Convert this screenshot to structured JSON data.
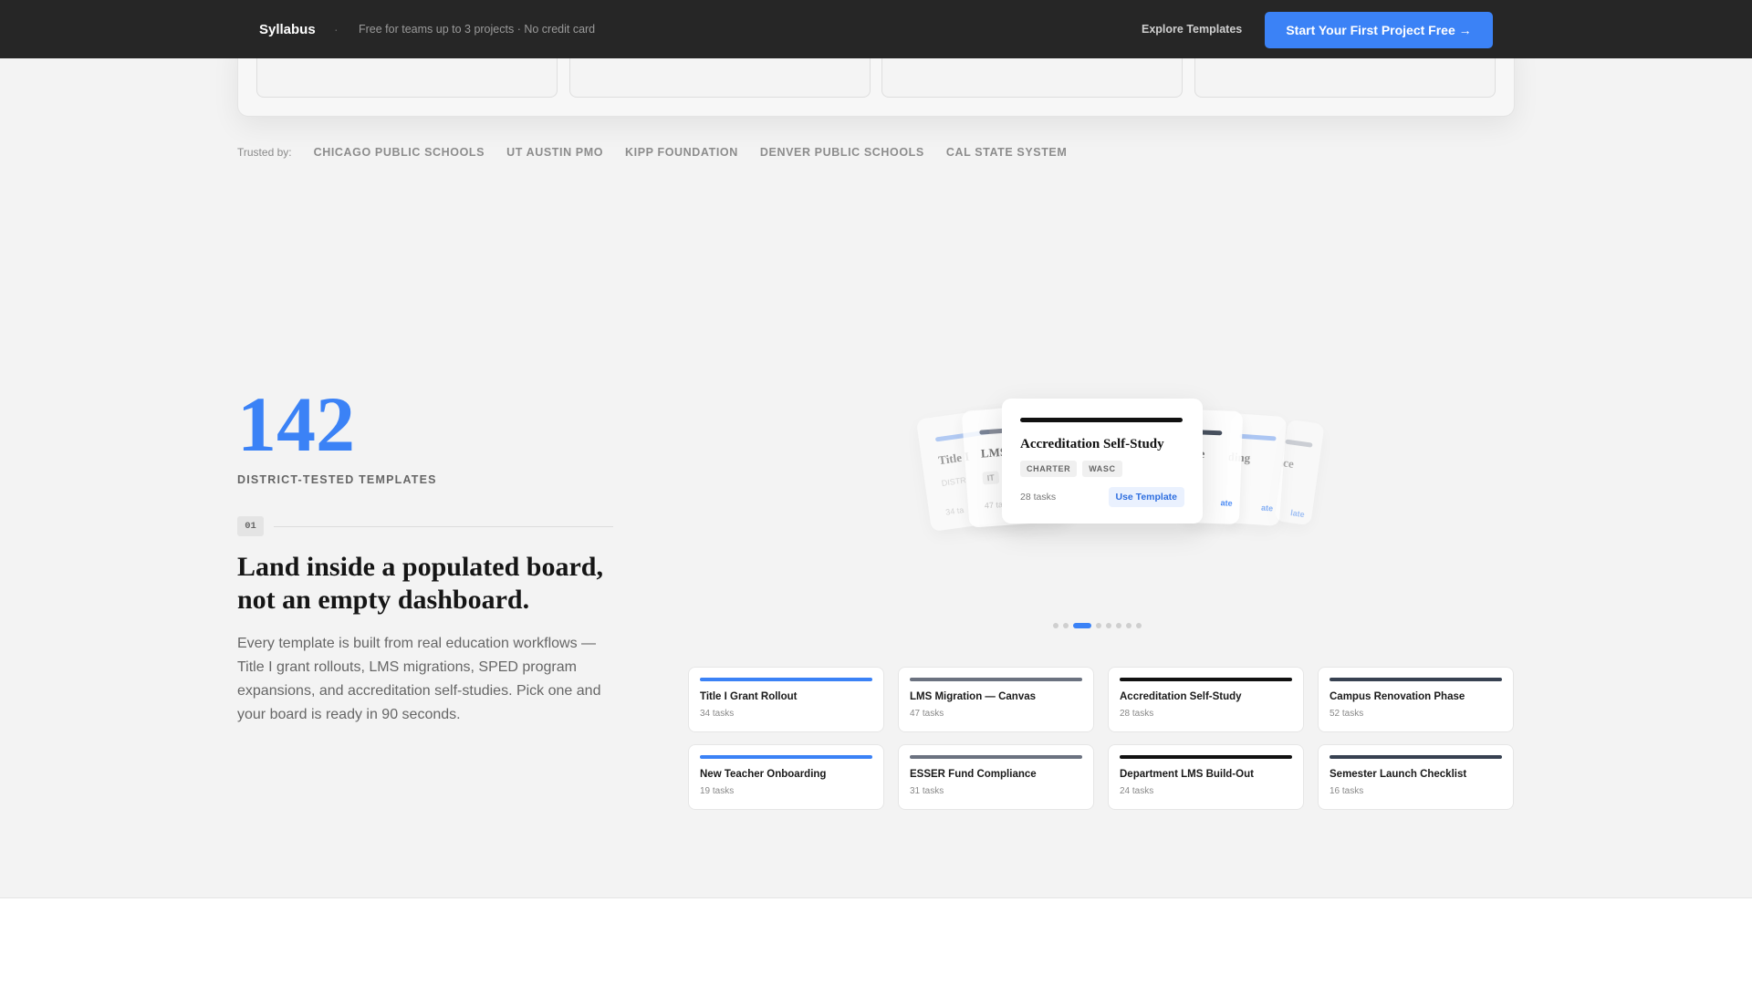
{
  "topbar": {
    "brand": "Syllabus",
    "separator": "·",
    "tagline": "Free for teams up to 3 projects · No credit card",
    "explore_link": "Explore Templates",
    "cta": "Start Your First Project Free →",
    "cta_color": "#3b82f6"
  },
  "trusted": {
    "label": "Trusted by:",
    "items": [
      "CHICAGO PUBLIC SCHOOLS",
      "UT AUSTIN PMO",
      "KIPP FOUNDATION",
      "DENVER PUBLIC SCHOOLS",
      "CAL STATE SYSTEM"
    ]
  },
  "stat": {
    "number": "142",
    "label": "DISTRICT-TESTED TEMPLATES"
  },
  "step": {
    "badge": "01",
    "headline": "Land inside a populated board, not an empty dashboard.",
    "body": "Every template is built from real education workflows — Title I grant rollouts, LMS migrations, SPED program expansions, and accreditation self-studies. Pick one and your board is ready in 90 seconds."
  },
  "carousel": {
    "ghosts": [
      {
        "title": "Title I",
        "sub": "DISTR",
        "tasks": "34 ta",
        "bar": "#7ea9f3"
      },
      {
        "title": "LMS",
        "sub": "IT",
        "tasks": "47 ta",
        "bar": "#6b7280"
      },
      {
        "title": "e",
        "sub": "",
        "tasks": "",
        "btn": "ate",
        "bar": "#374151"
      },
      {
        "title": "oarding",
        "sub": "",
        "tasks": "",
        "btn": "ate",
        "bar": "#7ea9f3"
      },
      {
        "title": "mpliance",
        "sub": "",
        "tasks": "",
        "btn": "late",
        "bar": "#9ca3af"
      }
    ],
    "active": {
      "title": "Accreditation Self-Study",
      "tags": [
        "CHARTER",
        "WASC"
      ],
      "tasks": "28 tasks",
      "button": "Use Template"
    },
    "dots_total": 8,
    "dots_active_index": 2
  },
  "templates": [
    {
      "name": "Title I Grant Rollout",
      "count": "34 tasks",
      "color": "#3b82f6"
    },
    {
      "name": "LMS Migration — Canvas",
      "count": "47 tasks",
      "color": "#6b7280"
    },
    {
      "name": "Accreditation Self-Study",
      "count": "28 tasks",
      "color": "#111111"
    },
    {
      "name": "Campus Renovation Phase",
      "count": "52 tasks",
      "color": "#374151"
    },
    {
      "name": "New Teacher Onboarding",
      "count": "19 tasks",
      "color": "#3b82f6"
    },
    {
      "name": "ESSER Fund Compliance",
      "count": "31 tasks",
      "color": "#6b7280"
    },
    {
      "name": "Department LMS Build-Out",
      "count": "24 tasks",
      "color": "#111111"
    },
    {
      "name": "Semester Launch Checklist",
      "count": "16 tasks",
      "color": "#374151"
    }
  ]
}
